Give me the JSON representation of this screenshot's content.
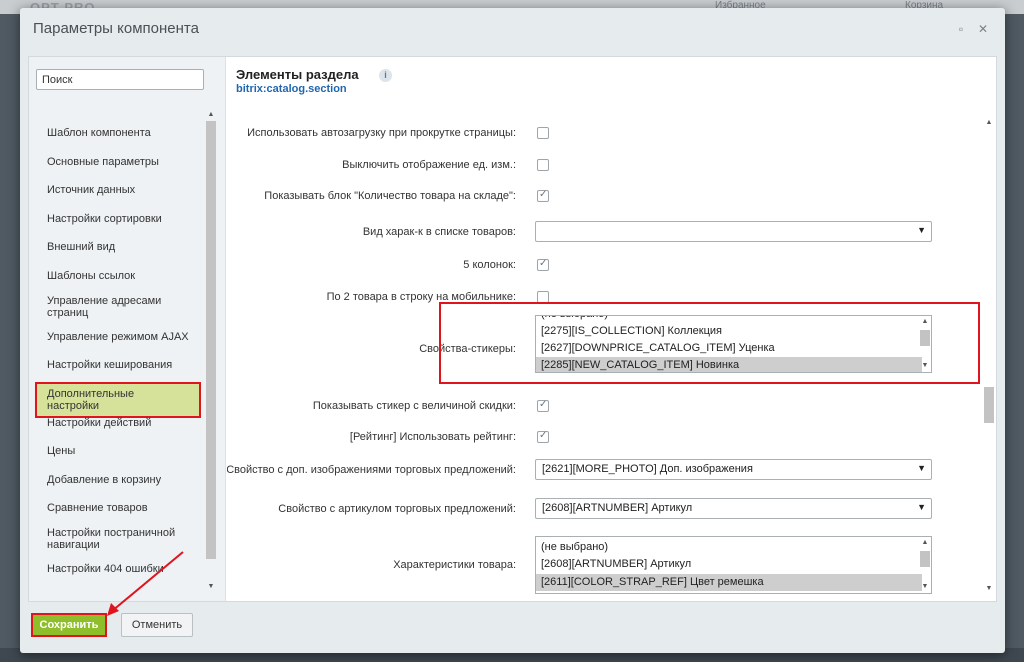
{
  "background": {
    "logo": "OPT PRO",
    "favorites": "Избранное",
    "cart": "Корзина"
  },
  "dialog": {
    "title": "Параметры компонента",
    "search_placeholder": "Поиск",
    "sidebar_items": [
      "Шаблон компонента",
      "Основные параметры",
      "Источник данных",
      "Настройки сортировки",
      "Внешний вид",
      "Шаблоны ссылок",
      "Управление адресами страниц",
      "Управление режимом AJAX",
      "Настройки кеширования",
      "Дополнительные настройки",
      "Настройки действий",
      "Цены",
      "Добавление в корзину",
      "Сравнение товаров",
      "Настройки постраничной навигации",
      "Настройки 404 ошибки"
    ],
    "active_sidebar_item": "Дополнительные настройки",
    "component_title": "Элементы раздела",
    "component_code": "bitrix:catalog.section",
    "params": {
      "autoload": {
        "label": "Использовать автозагрузку при прокрутке страницы:",
        "checked": false
      },
      "hide_units": {
        "label": "Выключить отображение ед. изм.:",
        "checked": false
      },
      "stock_block": {
        "label": "Показывать блок \"Количество товара на складе\":",
        "checked": true
      },
      "props_view": {
        "label": "Вид харак-к в списке товаров:",
        "value": ""
      },
      "five_cols": {
        "label": "5 колонок:",
        "checked": true
      },
      "mobile_two": {
        "label": "По 2 товара в строку на мобильнике:",
        "checked": false
      },
      "stickers": {
        "label": "Свойства-стикеры:",
        "options": [
          "(не выбрано)",
          "[2275][IS_COLLECTION] Коллекция",
          "[2627][DOWNPRICE_CATALOG_ITEM] Уценка",
          "[2285][NEW_CATALOG_ITEM] Новинка"
        ],
        "selected": "[2285][NEW_CATALOG_ITEM] Новинка"
      },
      "discount_sticker": {
        "label": "Показывать стикер с величиной скидки:",
        "checked": true
      },
      "rating": {
        "label": "[Рейтинг] Использовать рейтинг:",
        "checked": true
      },
      "offer_photo": {
        "label": "Свойство с доп. изображениями торговых предложений:",
        "value": "[2621][MORE_PHOTO] Доп. изображения"
      },
      "offer_article": {
        "label": "Свойство с артикулом торговых предложений:",
        "value": "[2608][ARTNUMBER] Артикул"
      },
      "characteristics": {
        "label": "Характеристики товара:",
        "options": [
          "(не выбрано)",
          "[2608][ARTNUMBER] Артикул",
          "[2611][COLOR_STRAP_REF] Цвет ремешка"
        ],
        "selected": "[2611][COLOR_STRAP_REF] Цвет ремешка"
      }
    },
    "buttons": {
      "save": "Сохранить",
      "cancel": "Отменить"
    }
  },
  "colors": {
    "highlight": "#e0141d",
    "save_button": "#8ebf2b",
    "link": "#2067b0"
  }
}
